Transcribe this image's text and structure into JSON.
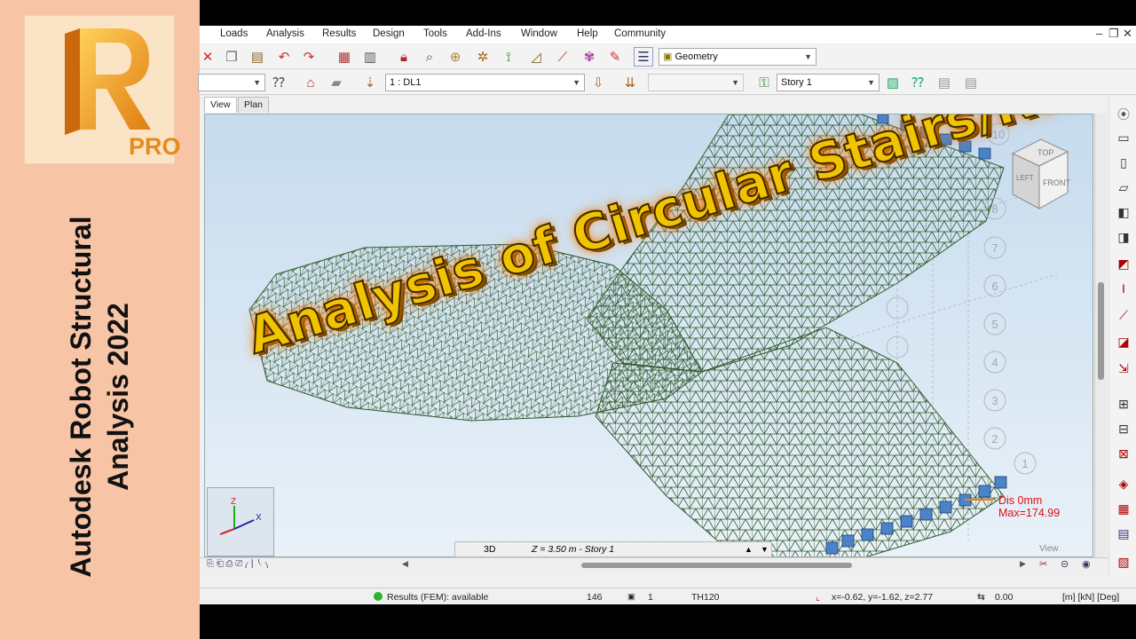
{
  "banner": {
    "logo_letter": "R",
    "logo_badge": "PRO",
    "title_line1": "Autodesk Robot Structural",
    "title_line2": "Analysis 2022"
  },
  "menu": [
    "Loads",
    "Analysis",
    "Results",
    "Design",
    "Tools",
    "Add-Ins",
    "Window",
    "Help",
    "Community"
  ],
  "window_controls": {
    "minimize": "‒",
    "restore": "❐",
    "close": "✕"
  },
  "toolbar": {
    "layout_combo": "Geometry",
    "load_case_combo": "1 : DL1",
    "story_combo": "Story 1"
  },
  "view_tabs": [
    "View",
    "Plan"
  ],
  "viewport": {
    "overlay_title": "Analysis of Circular Stairs/Ramps",
    "navcube_top": "TOP",
    "navcube_left": "LEFT",
    "navcube_front": "FRONT",
    "axis_z": "Z",
    "axis_x": "X",
    "dis_label": "Dis  0mm",
    "max_label": "Max=174.99",
    "corner_label": "View",
    "axis_markers": [
      "10",
      "9",
      "8",
      "7",
      "6",
      "5",
      "4",
      "3",
      "2",
      "1"
    ]
  },
  "viewbar": {
    "mode": "3D",
    "level": "Z = 3.50 m - Story 1"
  },
  "statusbar": {
    "results": "Results (FEM): available",
    "count": "146",
    "num": "1",
    "section": "TH120",
    "coords": "x=-0.62, y=-1.62, z=2.77",
    "value": "0.00",
    "units": "[m] [kN] [Deg]"
  },
  "colors": {
    "banner_bg": "#f7c4a5",
    "logo_orange": "#f0a12a",
    "mesh_green": "#2f5a2a",
    "title_yellow": "#f2c300",
    "dis_red": "#e01010"
  }
}
